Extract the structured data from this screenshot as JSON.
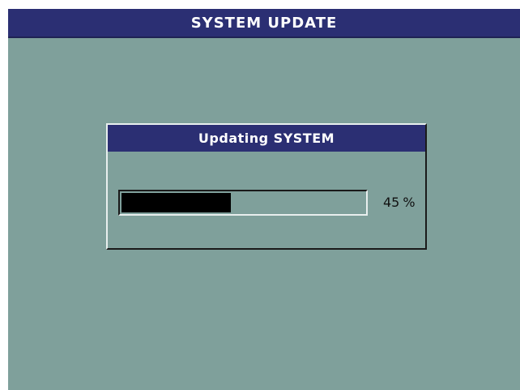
{
  "header": {
    "title": "SYSTEM UPDATE"
  },
  "dialog": {
    "title": "Updating SYSTEM",
    "progress": {
      "value": 45,
      "display_value": "45",
      "unit": "%"
    }
  },
  "colors": {
    "screen_bg": "#7fa09b",
    "title_bar": "#2b2f73",
    "progress_fill": "#000000"
  }
}
